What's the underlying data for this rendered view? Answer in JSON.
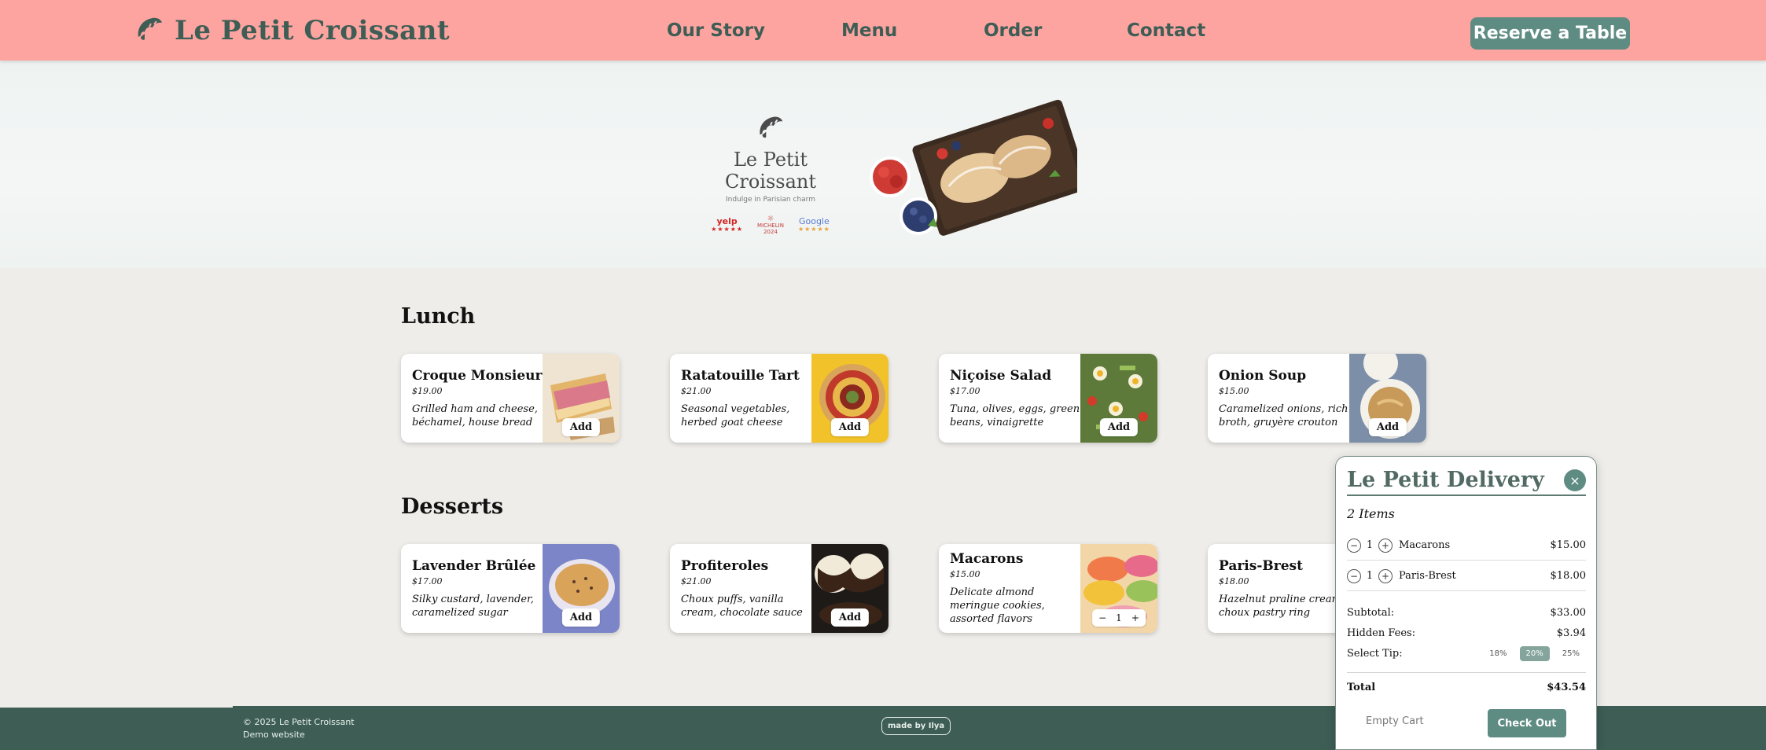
{
  "header": {
    "brand_name": "Le Petit Croissant",
    "nav": [
      "Our Story",
      "Menu",
      "Order",
      "Contact"
    ],
    "reserve_label": "Reserve a Table"
  },
  "hero": {
    "logo_title": "Le Petit Croissant",
    "tagline": "Indulge in Parisian charm",
    "badges": {
      "yelp": "yelp",
      "michelin": "MICHELIN",
      "michelin_year": "2024",
      "google": "Google"
    }
  },
  "sections": {
    "lunch_title": "Lunch",
    "desserts_title": "Desserts"
  },
  "lunch": [
    {
      "name": "Croque Monsieur",
      "price": "$19.00",
      "desc": "Grilled ham and cheese, béchamel, house bread",
      "button": "Add"
    },
    {
      "name": "Ratatouille Tart",
      "price": "$21.00",
      "desc": "Seasonal vegetables, herbed goat cheese",
      "button": "Add"
    },
    {
      "name": "Niçoise Salad",
      "price": "$17.00",
      "desc": "Tuna, olives, eggs, green beans, vinaigrette",
      "button": "Add"
    },
    {
      "name": "Onion Soup",
      "price": "$15.00",
      "desc": "Caramelized onions, rich broth, gruyère crouton",
      "button": "Add"
    }
  ],
  "desserts": [
    {
      "name": "Lavender Brûlée",
      "price": "$17.00",
      "desc": "Silky custard, lavender, caramelized sugar",
      "button": "Add"
    },
    {
      "name": "Profiteroles",
      "price": "$21.00",
      "desc": "Choux puffs, vanilla cream, chocolate sauce",
      "button": "Add"
    },
    {
      "name": "Macarons",
      "price": "$15.00",
      "desc": "Delicate almond meringue cookies, assorted flavors",
      "qty": "1",
      "minus": "−",
      "plus": "+"
    },
    {
      "name": "Paris-Brest",
      "price": "$18.00",
      "desc": "Hazelnut praline cream, choux pastry ring"
    }
  ],
  "cart": {
    "title": "Le Petit Delivery",
    "close": "×",
    "count_label": "2 Items",
    "items": [
      {
        "minus": "−",
        "qty": "1",
        "plus": "+",
        "name": "Macarons",
        "price": "$15.00"
      },
      {
        "minus": "−",
        "qty": "1",
        "plus": "+",
        "name": "Paris-Brest",
        "price": "$18.00"
      }
    ],
    "subtotal_label": "Subtotal:",
    "subtotal": "$33.00",
    "fees_label": "Hidden Fees:",
    "fees": "$3.94",
    "tip_label": "Select Tip:",
    "tips": [
      "18%",
      "20%",
      "25%"
    ],
    "selected_tip": "20%",
    "total_label": "Total",
    "total": "$43.54",
    "empty_label": "Empty Cart",
    "checkout_label": "Check Out"
  },
  "footer": {
    "copyright": "© 2025 Le Petit Croissant",
    "note": "Demo website",
    "made_by": "made by Ilya"
  },
  "colors": {
    "header_bg": "#fda4a0",
    "brand_green": "#3d5d55",
    "accent": "#5e8b82",
    "page_bg": "#efede9"
  }
}
